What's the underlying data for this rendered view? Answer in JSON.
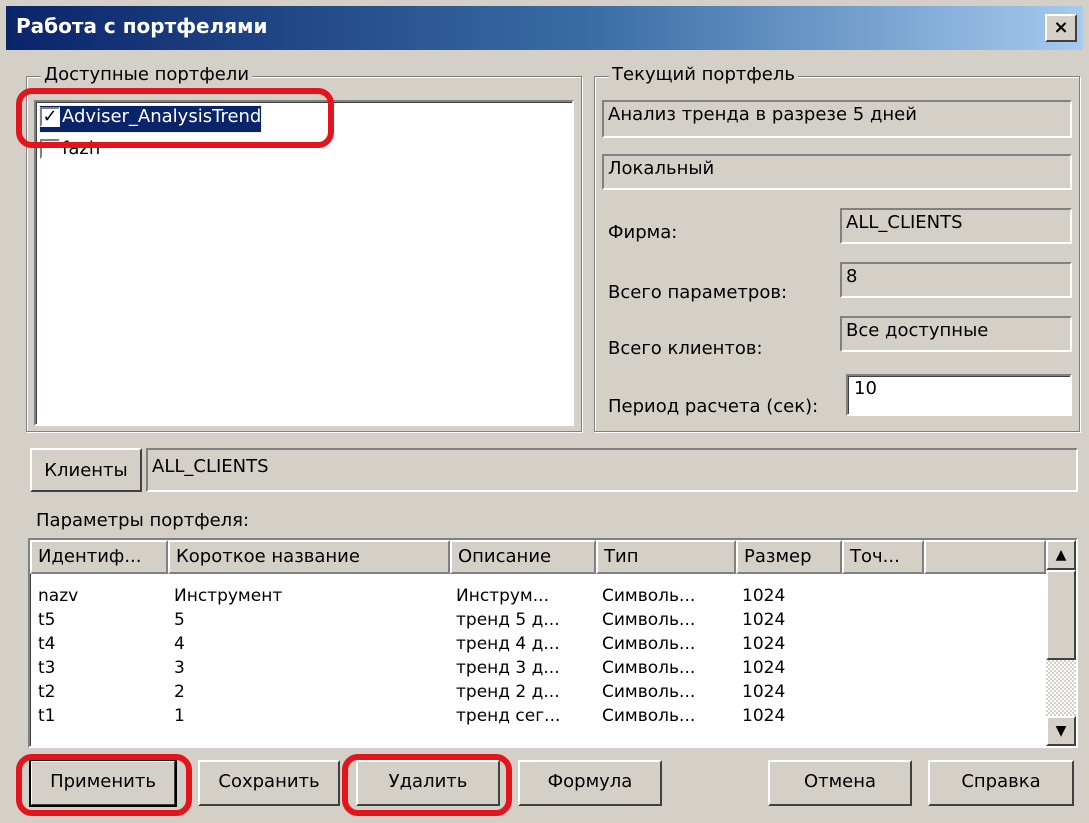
{
  "window": {
    "title": "Работа с портфелями",
    "close_glyph": "×"
  },
  "available": {
    "legend": "Доступные портфели",
    "items": [
      {
        "label": "Adviser_AnalysisTrend",
        "checked": true,
        "check_glyph": "✓"
      },
      {
        "label": "fazh",
        "checked": false,
        "check_glyph": ""
      }
    ]
  },
  "current": {
    "legend": "Текущий портфель",
    "name": "Анализ тренда в разрезе 5 дней",
    "type": "Локальный",
    "firm_label": "Фирма:",
    "firm_value": "ALL_CLIENTS",
    "params_label": "Всего параметров:",
    "params_value": "8",
    "clients_label": "Всего клиентов:",
    "clients_value": "Все доступные",
    "period_label": "Период расчета (сек):",
    "period_value": "10"
  },
  "clients": {
    "button_label": "Клиенты",
    "value": "ALL_CLIENTS"
  },
  "params": {
    "title": "Параметры портфеля:",
    "columns": [
      "Идентиф...",
      "Короткое название",
      "Описание",
      "Тип",
      "Размер",
      "Точ..."
    ],
    "rows": [
      [
        "nazv",
        "Инструмент",
        "Инструм...",
        "Символь...",
        "1024",
        ""
      ],
      [
        "t5",
        "5",
        "тренд 5 д...",
        "Символь...",
        "1024",
        ""
      ],
      [
        "t4",
        "4",
        "тренд 4 д...",
        "Символь...",
        "1024",
        ""
      ],
      [
        "t3",
        "3",
        "тренд 3 д...",
        "Символь...",
        "1024",
        ""
      ],
      [
        "t2",
        "2",
        "тренд 2 д...",
        "Символь...",
        "1024",
        ""
      ],
      [
        "t1",
        "1",
        "тренд сег...",
        "Символь...",
        "1024",
        ""
      ]
    ],
    "scroll_up_glyph": "▲",
    "scroll_down_glyph": "▼"
  },
  "buttons": {
    "apply": "Применить",
    "save": "Сохранить",
    "delete": "Удалить",
    "formula": "Формула",
    "cancel": "Отмена",
    "help": "Справка"
  },
  "colors": {
    "highlight_ring": "#e3141b",
    "title_bar": "#0a246a",
    "selection": "#0a246a"
  }
}
